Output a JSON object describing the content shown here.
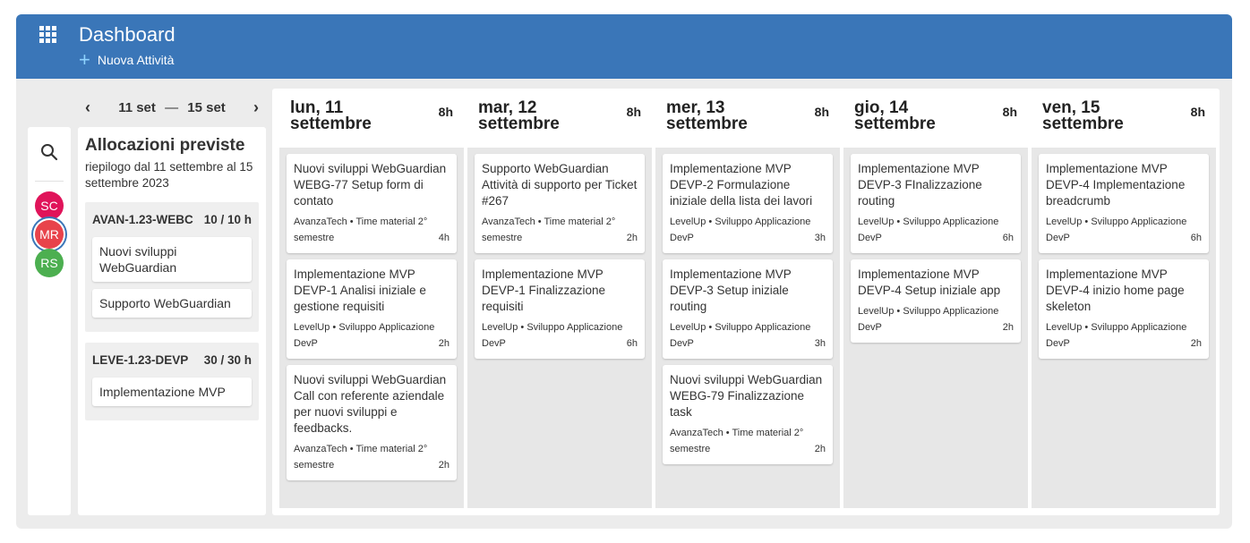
{
  "header": {
    "title": "Dashboard",
    "new_task_label": "Nuova Attività"
  },
  "week_nav": {
    "start": "11 set",
    "separator": "—",
    "end": "15 set"
  },
  "users": [
    {
      "initials": "SC",
      "color": "#e0145a"
    },
    {
      "initials": "MR",
      "color": "#e8434b",
      "selected": true
    },
    {
      "initials": "RS",
      "color": "#4caf50"
    }
  ],
  "allocations": {
    "title": "Allocazioni previste",
    "subtitle": "riepilogo dal 11 settembre al 15 settembre 2023",
    "groups": [
      {
        "code": "AVAN-1.23-WEBC",
        "hours": "10 / 10 h",
        "items": [
          "Nuovi sviluppi WebGuardian",
          "Supporto WebGuardian"
        ]
      },
      {
        "code": "LEVE-1.23-DEVP",
        "hours": "30 / 30 h",
        "items": [
          "Implementazione MVP"
        ]
      }
    ]
  },
  "days": [
    {
      "label": "lun, 11 settembre",
      "hours": "8h",
      "cards": [
        {
          "title": "Nuovi sviluppi WebGuardian WEBG-77 Setup form di contato",
          "sub": "AvanzaTech • Time material 2° semestre",
          "hours": "4h"
        },
        {
          "title": "Implementazione MVP DEVP-1 Analisi iniziale e gestione requisiti",
          "sub": "LevelUp • Sviluppo Applicazione DevP",
          "hours": "2h"
        },
        {
          "title": "Nuovi sviluppi WebGuardian Call con referente aziendale per nuovi sviluppi e feedbacks.",
          "sub": "AvanzaTech • Time material 2° semestre",
          "hours": "2h"
        }
      ]
    },
    {
      "label": "mar, 12 settembre",
      "hours": "8h",
      "cards": [
        {
          "title": "Supporto WebGuardian Attività di supporto per Ticket #267",
          "sub": "AvanzaTech • Time material 2° semestre",
          "hours": "2h"
        },
        {
          "title": "Implementazione MVP DEVP-1 Finalizzazione requisiti",
          "sub": "LevelUp • Sviluppo Applicazione DevP",
          "hours": "6h"
        }
      ]
    },
    {
      "label": "mer, 13 settembre",
      "hours": "8h",
      "cards": [
        {
          "title": "Implementazione MVP DEVP-2 Formulazione iniziale della lista dei lavori",
          "sub": "LevelUp • Sviluppo Applicazione DevP",
          "hours": "3h"
        },
        {
          "title": "Implementazione MVP DEVP-3 Setup iniziale routing",
          "sub": "LevelUp • Sviluppo Applicazione DevP",
          "hours": "3h"
        },
        {
          "title": "Nuovi sviluppi WebGuardian WEBG-79 Finalizzazione task",
          "sub": "AvanzaTech • Time material 2° semestre",
          "hours": "2h"
        }
      ]
    },
    {
      "label": "gio, 14 settembre",
      "hours": "8h",
      "cards": [
        {
          "title": "Implementazione MVP DEVP-3 FInalizzazione routing",
          "sub": "LevelUp • Sviluppo Applicazione DevP",
          "hours": "6h"
        },
        {
          "title": "Implementazione MVP DEVP-4 Setup iniziale app",
          "sub": "LevelUp • Sviluppo Applicazione DevP",
          "hours": "2h"
        }
      ]
    },
    {
      "label": "ven, 15 settembre",
      "hours": "8h",
      "cards": [
        {
          "title": "Implementazione MVP DEVP-4 Implementazione breadcrumb",
          "sub": "LevelUp • Sviluppo Applicazione DevP",
          "hours": "6h"
        },
        {
          "title": "Implementazione MVP DEVP-4 inizio home page skeleton",
          "sub": "LevelUp • Sviluppo Applicazione DevP",
          "hours": "2h"
        }
      ]
    }
  ]
}
